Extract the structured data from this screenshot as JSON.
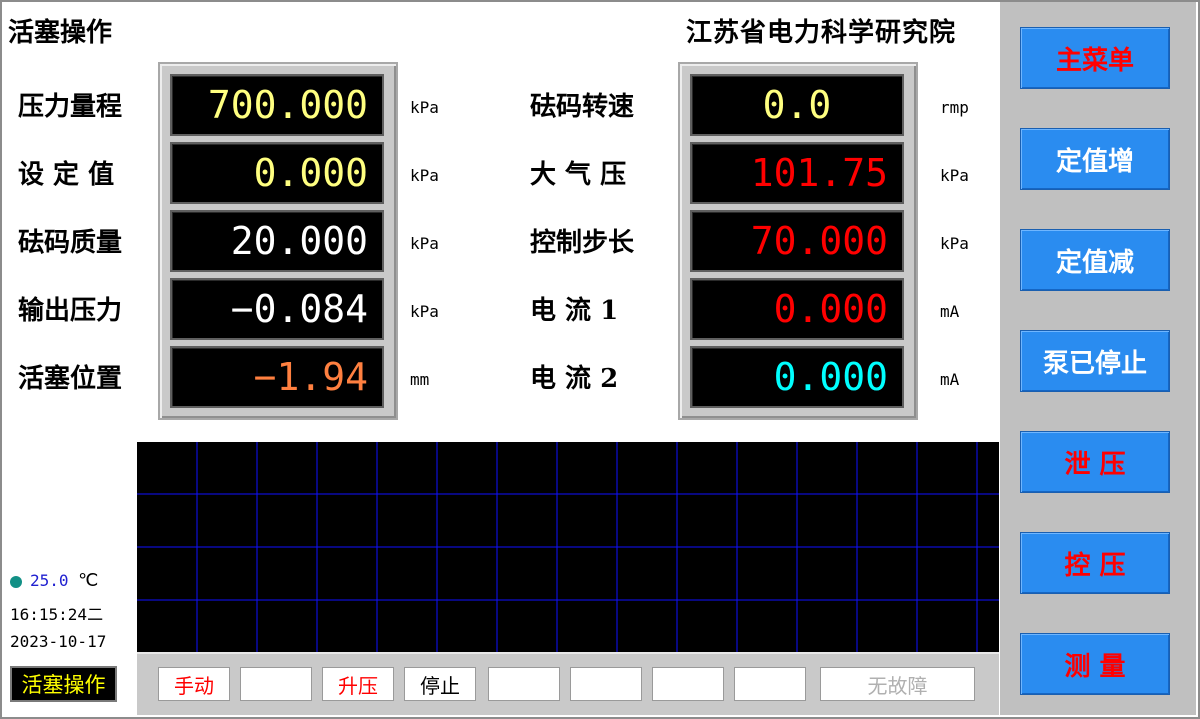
{
  "header": {
    "title_left": "活塞操作",
    "title_right": "江苏省电力科学研究院"
  },
  "left_rows": [
    {
      "label": "压力量程",
      "value": "700.000",
      "unit": "kPa",
      "color": "#ffff80"
    },
    {
      "label": "设 定 值",
      "value": "0.000",
      "unit": "kPa",
      "color": "#ffff80"
    },
    {
      "label": "砝码质量",
      "value": "20.000",
      "unit": "kPa",
      "color": "#ffffff"
    },
    {
      "label": "输出压力",
      "value": "−0.084",
      "unit": "kPa",
      "color": "#ffffff"
    },
    {
      "label": "活塞位置",
      "value": "−1.94",
      "unit": "mm",
      "color": "#ff8040"
    }
  ],
  "right_rows": [
    {
      "label": "砝码转速",
      "value": "0.0",
      "unit": "rmp",
      "color": "#ffff80"
    },
    {
      "label": "大 气 压",
      "value": "101.75",
      "unit": "kPa",
      "color": "#ff0000"
    },
    {
      "label": "控制步长",
      "value": "70.000",
      "unit": "kPa",
      "color": "#ff0000"
    },
    {
      "label": "电 流 1",
      "value": "0.000",
      "unit": "mA",
      "color": "#ff0000"
    },
    {
      "label": "电 流 2",
      "value": "0.000",
      "unit": "mA",
      "color": "#00ffff"
    }
  ],
  "side_buttons": [
    {
      "label": "主菜单",
      "color": "#ff0000",
      "name": "main-menu-button"
    },
    {
      "label": "定值增",
      "color": "#ffffff",
      "name": "setpoint-increase-button"
    },
    {
      "label": "定值减",
      "color": "#ffffff",
      "name": "setpoint-decrease-button"
    },
    {
      "label": "泵已停止",
      "color": "#ffffff",
      "name": "pump-stopped-button"
    },
    {
      "label": "泄 压",
      "color": "#ff0000",
      "name": "release-pressure-button"
    },
    {
      "label": "控 压",
      "color": "#ff0000",
      "name": "control-pressure-button"
    },
    {
      "label": "测 量",
      "color": "#ff0000",
      "name": "measure-button"
    }
  ],
  "status": {
    "temperature": "25.0",
    "temp_unit": "℃",
    "time": "16:15:24二",
    "date": "2023-10-17"
  },
  "mode_label": "活塞操作",
  "bottom_segments": [
    {
      "text": "手动",
      "color": "#ff0000"
    },
    {
      "text": "",
      "color": "#000000"
    },
    {
      "text": "升压",
      "color": "#ff0000"
    },
    {
      "text": "停止",
      "color": "#000000"
    },
    {
      "text": "",
      "color": "#000000"
    },
    {
      "text": "",
      "color": "#000000"
    },
    {
      "text": "",
      "color": "#000000"
    },
    {
      "text": "",
      "color": "#000000"
    },
    {
      "text": "无故障",
      "color": "#b0b0b0"
    }
  ],
  "graph": {
    "grid_color": "#1010ff",
    "background": "#000000"
  }
}
